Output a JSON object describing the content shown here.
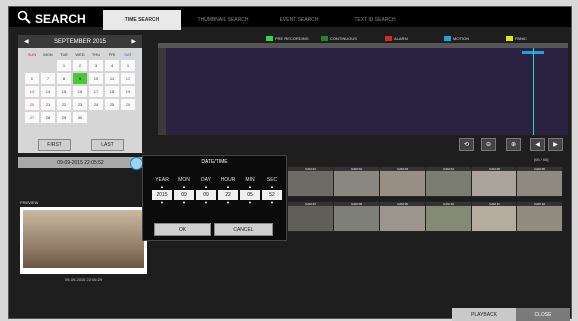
{
  "header": {
    "title": "SEARCH"
  },
  "tabs": [
    {
      "label": "TIME SEARCH"
    },
    {
      "label": "THUMBNAIL SEARCH"
    },
    {
      "label": "EVENT SEARCH"
    },
    {
      "label": "TEXT ID SEARCH"
    }
  ],
  "calendar": {
    "month_label": "SEPTEMBER 2015",
    "weekdays": [
      "SUN",
      "MON",
      "TUE",
      "WED",
      "THU",
      "FRI",
      "SAT"
    ],
    "days": [
      "",
      "",
      "1",
      "2",
      "3",
      "4",
      "5",
      "6",
      "7",
      "8",
      "9",
      "10",
      "11",
      "12",
      "13",
      "14",
      "15",
      "16",
      "17",
      "18",
      "19",
      "20",
      "21",
      "22",
      "23",
      "24",
      "25",
      "26",
      "27",
      "28",
      "29",
      "30",
      "",
      "",
      ""
    ],
    "selected_day": "9",
    "first_label": "FIRST",
    "last_label": "LAST"
  },
  "datetime_display": "09-09-2015  22:05:52",
  "legend": [
    {
      "label": "PRE RECORDING",
      "color": "#39d33d"
    },
    {
      "label": "CONTINUOUS",
      "color": "#2f7f2f"
    },
    {
      "label": "ALARM",
      "color": "#d62828"
    },
    {
      "label": "MOTION",
      "color": "#1ea0e6"
    },
    {
      "label": "PANIC",
      "color": "#e6e600"
    }
  ],
  "thumbnail_count": "[06 / 06]",
  "preview": {
    "label": "PREVIEW",
    "timestamp": "09-09-2015  22:06:29"
  },
  "thumbnails": [
    {
      "label": "CAM 01"
    },
    {
      "label": "CAM 02"
    },
    {
      "label": "CAM 03"
    },
    {
      "label": "CAM 04"
    },
    {
      "label": "CAM 05"
    },
    {
      "label": "CAM 06"
    },
    {
      "label": "CAM 07"
    },
    {
      "label": "CAM 08"
    },
    {
      "label": "CAM 09"
    },
    {
      "label": "CAM 10"
    },
    {
      "label": "CAM 11"
    },
    {
      "label": "CAM 12"
    }
  ],
  "modal": {
    "title": "DATE/TIME",
    "columns": [
      {
        "label": "YEAR",
        "value": "2015"
      },
      {
        "label": "MON",
        "value": "09"
      },
      {
        "label": "DAY",
        "value": "09"
      },
      {
        "label": "HOUR",
        "value": "22"
      },
      {
        "label": "MIN",
        "value": "05"
      },
      {
        "label": "SEC",
        "value": "52"
      }
    ],
    "ok_label": "OK",
    "cancel_label": "CANCEL"
  },
  "footer": {
    "playback_label": "PLAYBACK",
    "close_label": "CLOSE"
  },
  "icons": [
    "search-icon",
    "prev-month-icon",
    "next-month-icon",
    "calendar-clock-icon",
    "refresh-icon",
    "zoom-out-icon",
    "zoom-in-icon",
    "prev-icon",
    "next-icon"
  ]
}
